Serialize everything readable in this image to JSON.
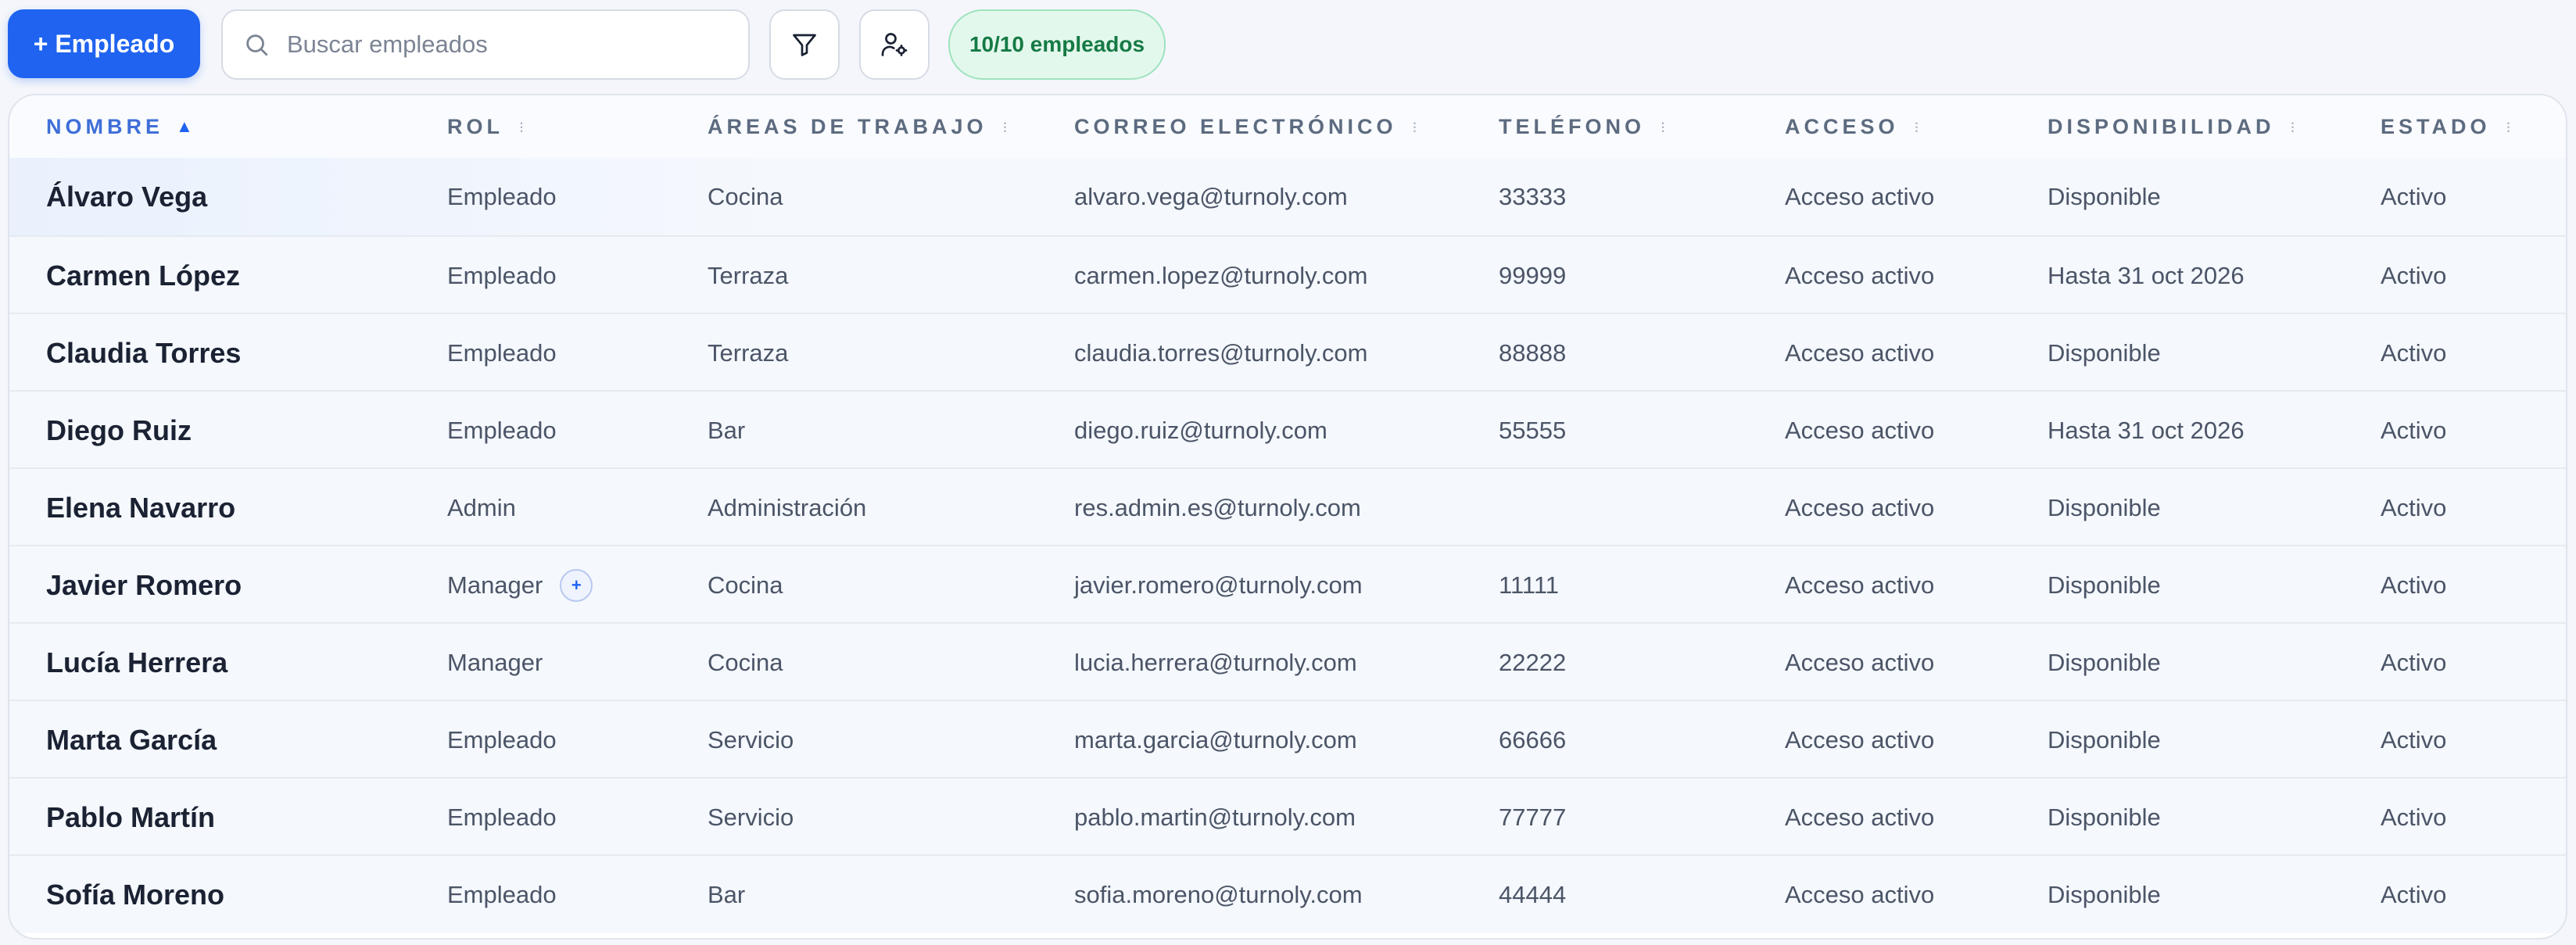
{
  "toolbar": {
    "add_button_label": "+ Empleado",
    "search_placeholder": "Buscar empleados",
    "search_value": "",
    "filter_icon": "filter-icon",
    "user_settings_icon": "user-settings-icon",
    "count_badge": "10/10 empleados"
  },
  "table": {
    "columns": [
      {
        "key": "nombre",
        "label": "NOMBRE",
        "sort": "asc"
      },
      {
        "key": "rol",
        "label": "ROL",
        "sort": "none"
      },
      {
        "key": "areas",
        "label": "ÁREAS DE TRABAJO",
        "sort": "none"
      },
      {
        "key": "correo",
        "label": "CORREO ELECTRÓNICO",
        "sort": "none"
      },
      {
        "key": "telefono",
        "label": "TELÉFONO",
        "sort": "none"
      },
      {
        "key": "acceso",
        "label": "ACCESO",
        "sort": "none"
      },
      {
        "key": "disponibilidad",
        "label": "DISPONIBILIDAD",
        "sort": "none"
      },
      {
        "key": "estado",
        "label": "ESTADO",
        "sort": "none"
      }
    ],
    "rows": [
      {
        "nombre": "Álvaro Vega",
        "rol": "Empleado",
        "rol_extra": false,
        "areas": "Cocina",
        "correo": "alvaro.vega@turnoly.com",
        "telefono": "33333",
        "acceso": "Acceso activo",
        "disponibilidad": "Disponible",
        "estado": "Activo"
      },
      {
        "nombre": "Carmen López",
        "rol": "Empleado",
        "rol_extra": false,
        "areas": "Terraza",
        "correo": "carmen.lopez@turnoly.com",
        "telefono": "99999",
        "acceso": "Acceso activo",
        "disponibilidad": "Hasta 31 oct 2026",
        "estado": "Activo"
      },
      {
        "nombre": "Claudia Torres",
        "rol": "Empleado",
        "rol_extra": false,
        "areas": "Terraza",
        "correo": "claudia.torres@turnoly.com",
        "telefono": "88888",
        "acceso": "Acceso activo",
        "disponibilidad": "Disponible",
        "estado": "Activo"
      },
      {
        "nombre": "Diego Ruiz",
        "rol": "Empleado",
        "rol_extra": false,
        "areas": "Bar",
        "correo": "diego.ruiz@turnoly.com",
        "telefono": "55555",
        "acceso": "Acceso activo",
        "disponibilidad": "Hasta 31 oct 2026",
        "estado": "Activo"
      },
      {
        "nombre": "Elena Navarro",
        "rol": "Admin",
        "rol_extra": false,
        "areas": "Administración",
        "correo": "res.admin.es@turnoly.com",
        "telefono": "",
        "acceso": "Acceso activo",
        "disponibilidad": "Disponible",
        "estado": "Activo"
      },
      {
        "nombre": "Javier Romero",
        "rol": "Manager",
        "rol_extra": true,
        "rol_extra_label": "+",
        "areas": "Cocina",
        "correo": "javier.romero@turnoly.com",
        "telefono": "11111",
        "acceso": "Acceso activo",
        "disponibilidad": "Disponible",
        "estado": "Activo"
      },
      {
        "nombre": "Lucía Herrera",
        "rol": "Manager",
        "rol_extra": false,
        "areas": "Cocina",
        "correo": "lucia.herrera@turnoly.com",
        "telefono": "22222",
        "acceso": "Acceso activo",
        "disponibilidad": "Disponible",
        "estado": "Activo"
      },
      {
        "nombre": "Marta García",
        "rol": "Empleado",
        "rol_extra": false,
        "areas": "Servicio",
        "correo": "marta.garcia@turnoly.com",
        "telefono": "66666",
        "acceso": "Acceso activo",
        "disponibilidad": "Disponible",
        "estado": "Activo"
      },
      {
        "nombre": "Pablo Martín",
        "rol": "Empleado",
        "rol_extra": false,
        "areas": "Servicio",
        "correo": "pablo.martin@turnoly.com",
        "telefono": "77777",
        "acceso": "Acceso activo",
        "disponibilidad": "Disponible",
        "estado": "Activo"
      },
      {
        "nombre": "Sofía Moreno",
        "rol": "Empleado",
        "rol_extra": false,
        "areas": "Bar",
        "correo": "sofia.moreno@turnoly.com",
        "telefono": "44444",
        "acceso": "Acceso activo",
        "disponibilidad": "Disponible",
        "estado": "Activo"
      }
    ]
  },
  "colors": {
    "accent": "#1f63f0",
    "badge_bg": "#e3f8ec",
    "badge_text": "#157a45"
  }
}
